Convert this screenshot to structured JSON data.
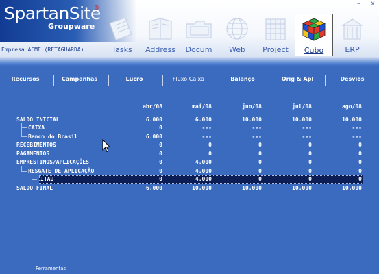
{
  "app": {
    "brand": "SpartanSite",
    "registered": "®",
    "brand_sub": "Groupware",
    "company": "Empresa ACME (RETAGUARDA)",
    "window_controls": [
      "–",
      "x"
    ]
  },
  "modules": [
    {
      "label": "Tasks",
      "icon": "tasks-icon"
    },
    {
      "label": "Address",
      "icon": "address-book-icon"
    },
    {
      "label": "Docum",
      "icon": "folder-icon"
    },
    {
      "label": "Web",
      "icon": "globe-icon"
    },
    {
      "label": "Project",
      "icon": "project-icon"
    },
    {
      "label": "Cubo",
      "icon": "cube-icon",
      "active": true
    },
    {
      "label": "ERP",
      "icon": "erp-icon"
    }
  ],
  "tabs": [
    "Recursos",
    "Campanhas",
    "Lucro",
    "Fluxo Caixa",
    "Balanço",
    "Orig & Apl",
    "Desvios"
  ],
  "grid": {
    "columns": [
      "abr/08",
      "mai/08",
      "jun/08",
      "jul/08",
      "ago/08"
    ],
    "rows": [
      {
        "label": "SALDO INICIAL",
        "values": [
          "6.000",
          "6.000",
          "10.000",
          "10.000",
          "10.000"
        ]
      },
      {
        "label": "CAIXA",
        "values": [
          "0",
          "---",
          "---",
          "---",
          "---"
        ]
      },
      {
        "label": "Banco do Brasil",
        "values": [
          "6.000",
          "---",
          "---",
          "---",
          "---"
        ]
      },
      {
        "label": "RECEBIMENTOS",
        "values": [
          "0",
          "0",
          "0",
          "0",
          "0"
        ]
      },
      {
        "label": "PAGAMENTOS",
        "values": [
          "0",
          "0",
          "0",
          "0",
          "0"
        ]
      },
      {
        "label": "EMPRESTIMOS/APLICAÇÕES",
        "values": [
          "0",
          "4.000",
          "0",
          "0",
          "0"
        ]
      },
      {
        "label": "RESGATE DE APLICAÇÃO",
        "values": [
          "0",
          "4.000",
          "0",
          "0",
          "0"
        ]
      },
      {
        "label": "ITAU",
        "values": [
          "0",
          "4.000",
          "0",
          "0",
          "0"
        ]
      },
      {
        "label": "SALDO FINAL",
        "values": [
          "6.000",
          "10.000",
          "10.000",
          "10.000",
          "10.000"
        ]
      }
    ]
  },
  "footer": {
    "label": "Ferramentas"
  },
  "colors": {
    "background": "#3a6bbf",
    "selected_row": "#0b1d55",
    "text": "#ffffff",
    "brand_red": "#d01010"
  }
}
